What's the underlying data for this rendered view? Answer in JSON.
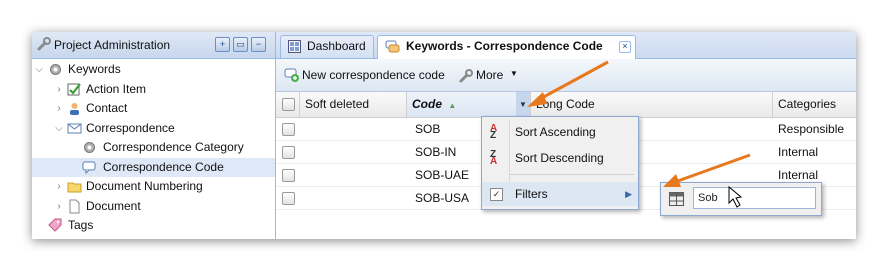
{
  "left_panel": {
    "title": "Project Administration",
    "tree": [
      {
        "label": "Keywords",
        "indent": 0,
        "expanded": true,
        "icon": "gear-icon"
      },
      {
        "label": "Action Item",
        "indent": 1,
        "icon": "checkbox-icon"
      },
      {
        "label": "Contact",
        "indent": 1,
        "icon": "person-icon"
      },
      {
        "label": "Correspondence",
        "indent": 1,
        "expanded": true,
        "icon": "envelope-icon"
      },
      {
        "label": "Correspondence Category",
        "indent": 2,
        "icon": "gear-icon"
      },
      {
        "label": "Correspondence Code",
        "indent": 2,
        "icon": "speech-bubble-icon",
        "selected": true
      },
      {
        "label": "Document Numbering",
        "indent": 1,
        "icon": "folder-icon"
      },
      {
        "label": "Document",
        "indent": 1,
        "icon": "document-icon"
      },
      {
        "label": "Tags",
        "indent": 0,
        "icon": "tag-icon"
      }
    ]
  },
  "tabs": [
    {
      "label": "Dashboard",
      "icon": "dashboard-icon"
    },
    {
      "label": "Keywords - Correspondence Code",
      "icon": "keywords-icon",
      "active": true
    }
  ],
  "toolbar": {
    "new_label": "New correspondence code",
    "more_label": "More"
  },
  "grid": {
    "columns": [
      "Soft deleted",
      "Code",
      "Long Code",
      "Categories"
    ],
    "rows": [
      {
        "code": "SOB",
        "category": "Responsible"
      },
      {
        "code": "SOB-IN",
        "category": "Internal"
      },
      {
        "code": "SOB-UAE",
        "category": "Internal"
      },
      {
        "code": "SOB-USA",
        "category": ""
      }
    ]
  },
  "column_menu": {
    "sort_ascending": "Sort Ascending",
    "sort_descending": "Sort Descending",
    "filters": "Filters",
    "filter_value": "Sob"
  },
  "colors": {
    "accent": "#99bbe8",
    "arrow": "#e8781e",
    "selected_row": "#dfe8f6"
  }
}
